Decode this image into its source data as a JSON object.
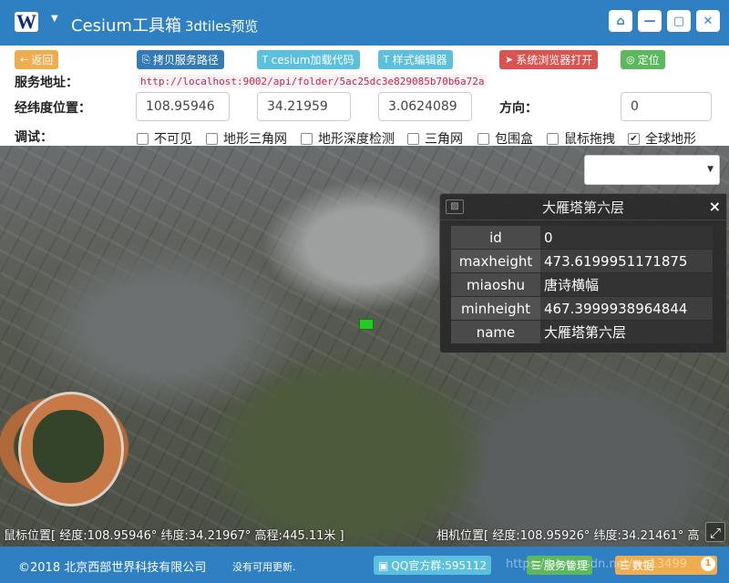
{
  "header": {
    "logo_text": "W",
    "title": "Cesium工具箱",
    "subtitle": "3dtiles预览",
    "window_buttons": [
      "⌂",
      "—",
      "▢",
      "✕"
    ]
  },
  "toolbar": {
    "back_label": "返回",
    "copy_path_label": "拷贝服务路径",
    "load_code_label": "cesium加载代码",
    "style_editor_label": "样式编辑器",
    "system_browser_label": "系统浏览器打开",
    "locate_label": "定位",
    "colors": {
      "back": "#f0ad4e",
      "copy": "#337ab7",
      "code": "#5bc0de",
      "style": "#5bc0de",
      "browser": "#d9534f",
      "locate": "#5cb85c"
    }
  },
  "service": {
    "label": "服务地址：",
    "url": "http://localhost:9002/api/folder/5ac25dc3e829085b70b6a72a"
  },
  "position": {
    "label": "经纬度位置：",
    "longitude": "108.95946",
    "latitude": "34.21959",
    "height": "3.0624089",
    "direction_label": "方向：",
    "direction": "0"
  },
  "debug": {
    "label": "调试：",
    "options": [
      {
        "label": "不可见",
        "checked": false
      },
      {
        "label": "地形三角网",
        "checked": false
      },
      {
        "label": "地形深度检测",
        "checked": false
      },
      {
        "label": "三角网",
        "checked": false
      },
      {
        "label": "包围盒",
        "checked": false
      },
      {
        "label": "鼠标拖拽",
        "checked": false
      },
      {
        "label": "全球地形",
        "checked": true
      }
    ]
  },
  "infobox": {
    "title": "大雁塔第六层",
    "rows": [
      {
        "key": "id",
        "value": "0"
      },
      {
        "key": "maxheight",
        "value": "473.6199951171875"
      },
      {
        "key": "miaoshu",
        "value": "唐诗横幅"
      },
      {
        "key": "minheight",
        "value": "467.3999938964844"
      },
      {
        "key": "name",
        "value": "大雁塔第六层"
      }
    ]
  },
  "status": {
    "mouse": "鼠标位置[ 经度:108.95946° 纬度:34.21967° 高程:445.11米 ]",
    "camera": "相机位置[ 经度:108.95926° 纬度:34.21461° 高"
  },
  "footer": {
    "copyright": "©2018 北京西部世界科技有限公司",
    "update_note": "没有可用更新.",
    "qq_label": "QQ官方群:595112",
    "service_label": "服务管理",
    "data_label": "数据",
    "badge": "1",
    "watermark": "https://blog.csdn.net/wo13499"
  }
}
